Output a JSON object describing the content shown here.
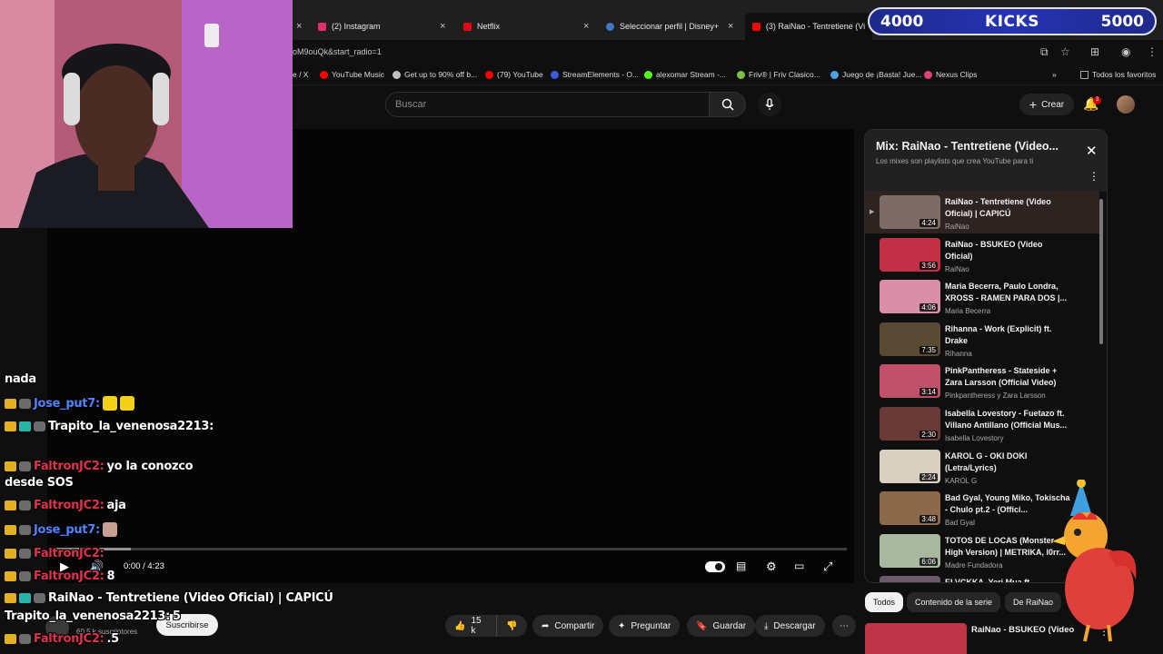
{
  "tabs": [
    {
      "label": "(2) Instagram",
      "color": "#e1306c"
    },
    {
      "label": "Netflix",
      "color": "#e50914"
    },
    {
      "label": "Seleccionar perfil | Disney+",
      "color": "#3c78c8"
    },
    {
      "label": "(3) RaiNao - Tentretiene (Video",
      "color": "#ff0000"
    }
  ],
  "address": {
    "url": "oM9ouQk&start_radio=1"
  },
  "bookmarks": [
    {
      "label": "e / X",
      "color": "#888888"
    },
    {
      "label": "YouTube Music",
      "color": "#ff0000"
    },
    {
      "label": "Get up to 90% off b...",
      "color": "#c0c0c0"
    },
    {
      "label": "(79) YouTube",
      "color": "#ff0000"
    },
    {
      "label": "StreamElements - O...",
      "color": "#3b5bdb"
    },
    {
      "label": "alexomar Stream -...",
      "color": "#53fc18"
    },
    {
      "label": "Friv® | Friv Clasico...",
      "color": "#7ac142"
    },
    {
      "label": "Juego de ¡Basta! Jue...",
      "color": "#4aa3df"
    },
    {
      "label": "Nexus Clips",
      "color": "#e0407b"
    },
    {
      "label": "»",
      "color": ""
    },
    {
      "label": "Todos los favoritos",
      "color": "#aaaaaa"
    }
  ],
  "header": {
    "search_placeholder": "Buscar",
    "create_label": "Crear",
    "notif_count": "3"
  },
  "player": {
    "time": "0:00 / 4:23"
  },
  "below": {
    "subscribers": "60.5 k suscriptores",
    "subscribe": "Suscribirse",
    "likes": "15 k",
    "share": "Compartir",
    "ask": "Preguntar",
    "save": "Guardar",
    "download": "Descargar"
  },
  "playlist": {
    "title": "Mix: RaiNao - Tentretiene (Video...",
    "subtitle": "Los mixes son playlists que crea YouTube para ti",
    "items": [
      {
        "title": "RaiNao - Tentretiene (Video Oficial) | CAPICÚ",
        "channel": "RaiNao",
        "duration": "4:24",
        "thumb": "#7d6c66"
      },
      {
        "title": "RaiNao - BSUKEO (Video Oficial)",
        "channel": "RaiNao",
        "duration": "3:56",
        "thumb": "#c23045"
      },
      {
        "title": "Maria Becerra, Paulo Londra, XROSS - RAMEN PARA DOS |...",
        "channel": "Maria Becerra",
        "duration": "4:06",
        "thumb": "#d98fa8"
      },
      {
        "title": "Rihanna - Work (Explicit) ft. Drake",
        "channel": "Rihanna",
        "duration": "7:35",
        "thumb": "#5a4a34"
      },
      {
        "title": "PinkPantheress - Stateside + Zara Larsson (Official Video)",
        "channel": "Pinkpantheress y Zara Larsson",
        "duration": "3:14",
        "thumb": "#c0506a"
      },
      {
        "title": "Isabella Lovestory - Fuetazo ft. Villano Antillano (Official Mus...",
        "channel": "Isabella Lovestory",
        "duration": "2:30",
        "thumb": "#6a3a38"
      },
      {
        "title": "KAROL G - OKI DOKI (Letra/Lyrics)",
        "channel": "KAROL G",
        "duration": "2:24",
        "thumb": "#d9d0c2"
      },
      {
        "title": "Bad Gyal, Young Miko, Tokischa - Chulo pt.2 - (Offici...",
        "channel": "Bad Gyal",
        "duration": "3:48",
        "thumb": "#8a6a4a"
      },
      {
        "title": "TOTOS DE LOCAS (Monster High Version) | METRIKA, l0rr...",
        "channel": "Madre Fundadora",
        "duration": "6:06",
        "thumb": "#a8b8a0"
      },
      {
        "title": "ELVCKKA, Yeri Mua ft.",
        "channel": "",
        "duration": "",
        "thumb": "#6a5a6a"
      }
    ]
  },
  "chips": [
    "Todos",
    "Contenido de la serie",
    "De RaiNao"
  ],
  "next_video": {
    "title": "RaiNao - BSUKEO (Video"
  },
  "chat": [
    {
      "user": "",
      "text": "nada",
      "ucolor": "white",
      "badges": 0
    },
    {
      "user": "Jose_put7:",
      "text": "",
      "ucolor": "blue",
      "badges": 2,
      "emotes": [
        "#f3d018",
        "#f3d018"
      ]
    },
    {
      "user": "Trapito_la_venenosa2213:",
      "text": "",
      "ucolor": "white",
      "badges": 3
    },
    {
      "user": "FaltronJC2:",
      "text": "yo la conozco",
      "ucolor": "red",
      "badges": 2
    },
    {
      "user": "",
      "text": "desde SOS",
      "ucolor": "white",
      "badges": 0
    },
    {
      "user": "FaltronJC2:",
      "text": "aja",
      "ucolor": "red",
      "badges": 2
    },
    {
      "user": "Jose_put7:",
      "text": "",
      "ucolor": "blue",
      "badges": 2,
      "emotes": [
        "#c8a090"
      ]
    },
    {
      "user": "FaltronJC2:",
      "text": "",
      "ucolor": "red",
      "badges": 2
    },
    {
      "user": "FaltronJC2:",
      "text": "8",
      "ucolor": "red",
      "badges": 2
    },
    {
      "user": "",
      "text": "RaiNao - Tentretiene (Video Oficial) | CAPICÚ",
      "ucolor": "white",
      "badges": 3
    },
    {
      "user": "Trapito_la_venenosa2213:",
      "text": "5",
      "ucolor": "white",
      "badges": 0
    },
    {
      "user": "FaltronJC2:",
      "text": ".5",
      "ucolor": "red",
      "badges": 2
    }
  ],
  "counter": {
    "left": "4000",
    "center": "KICKS",
    "right": "5000"
  }
}
